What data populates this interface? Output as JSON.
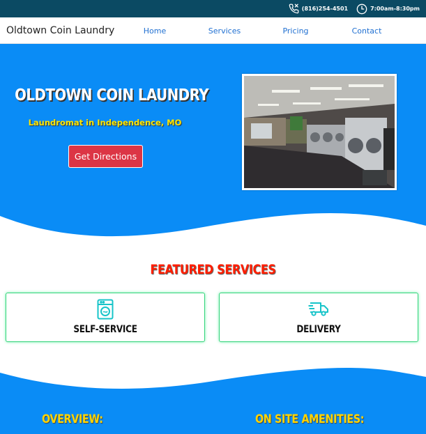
{
  "topbar": {
    "phone": "(816)254-4501",
    "hours": "7:00am-8:30pm",
    "phone_icon": "phone-icon",
    "hours_icon": "clock-icon",
    "background": "#0b4a63"
  },
  "nav": {
    "brand": "Oldtown Coin Laundry",
    "links": [
      "Home",
      "Services",
      "Pricing",
      "Contact"
    ]
  },
  "hero": {
    "title": "OLDTOWN COIN LAUNDRY",
    "subtitle": "Laundromat in Independence, MO",
    "button": "Get Directions",
    "background": "#0a8cf6",
    "button_color": "#dc3545",
    "subtitle_color": "#ffe600"
  },
  "services": {
    "heading": "FEATURED SERVICES",
    "heading_color": "#ff1e00",
    "cards": [
      {
        "label": "SELF-SERVICE",
        "icon": "washing-machine-icon"
      },
      {
        "label": "DELIVERY",
        "icon": "delivery-truck-icon"
      }
    ]
  },
  "sections": {
    "overview": "OVERVIEW:",
    "amenities": "ON SITE AMENITIES:",
    "heading_color": "#ffd400"
  }
}
